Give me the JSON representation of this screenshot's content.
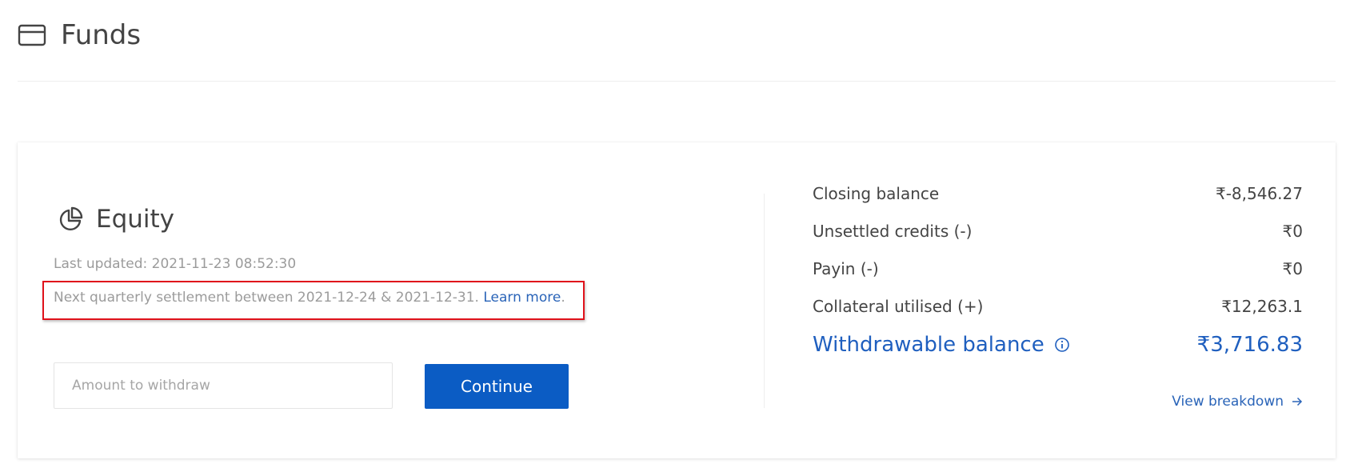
{
  "header": {
    "title": "Funds",
    "icon": "card-icon"
  },
  "equity": {
    "title": "Equity",
    "icon": "pie-chart-icon",
    "last_updated": "Last updated: 2021-11-23 08:52:30",
    "settlement_text": "Next quarterly settlement between 2021-12-24 & 2021-12-31. ",
    "learn_more": "Learn more",
    "learn_more_suffix": "."
  },
  "withdraw": {
    "placeholder": "Amount to withdraw",
    "value": "",
    "continue_label": "Continue"
  },
  "summary": {
    "rows": [
      {
        "label": "Closing balance",
        "value": "₹-8,546.27"
      },
      {
        "label": "Unsettled credits (-)",
        "value": "₹0"
      },
      {
        "label": "Payin (-)",
        "value": "₹0"
      },
      {
        "label": "Collateral utilised (+)",
        "value": "₹12,263.1"
      }
    ],
    "withdrawable_label": "Withdrawable balance",
    "withdrawable_value": "₹3,716.83",
    "view_breakdown": "View breakdown"
  },
  "colors": {
    "primary": "#0b5cc4",
    "link": "#2a64b8",
    "highlight_border": "#e0121b",
    "muted_text": "#9b9b9b",
    "text": "#444444"
  }
}
